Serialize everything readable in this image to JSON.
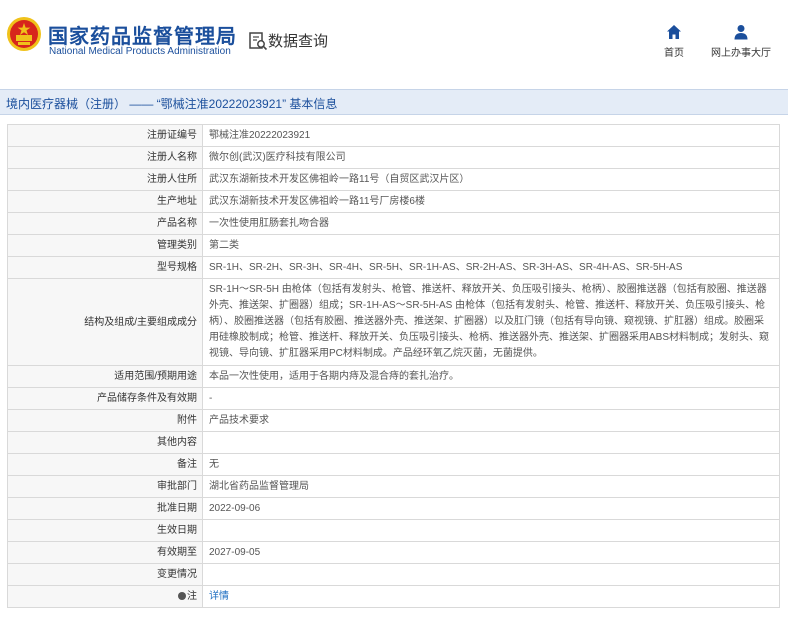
{
  "header": {
    "brand_cn": "国家药品监督管理局",
    "brand_en": "National Medical Products Administration",
    "query_title": "数据查询",
    "nav": {
      "home": "首页",
      "hall": "网上办事大厅"
    },
    "colors": {
      "brand": "#1b4f9c",
      "logo_red": "#d7261c",
      "logo_gold": "#f0c21a"
    }
  },
  "title_bar": {
    "text": "境内医疗器械（注册） —— “鄂械注准20222023921” 基本信息"
  },
  "rows": [
    {
      "label": "注册证编号",
      "value": "鄂械注准20222023921"
    },
    {
      "label": "注册人名称",
      "value": "微尔创(武汉)医疗科技有限公司"
    },
    {
      "label": "注册人住所",
      "value": "武汉东湖新技术开发区佛祖岭一路11号（自贸区武汉片区）"
    },
    {
      "label": "生产地址",
      "value": "武汉东湖新技术开发区佛祖岭一路11号厂房楼6楼"
    },
    {
      "label": "产品名称",
      "value": "一次性使用肛肠套扎吻合器"
    },
    {
      "label": "管理类别",
      "value": "第二类"
    },
    {
      "label": "型号规格",
      "value": "SR-1H、SR-2H、SR-3H、SR-4H、SR-5H、SR-1H-AS、SR-2H-AS、SR-3H-AS、SR-4H-AS、SR-5H-AS"
    },
    {
      "label": "结构及组成/主要组成成分",
      "value": "SR-1H～SR-5H 由枪体（包括有发射头、枪管、推送杆、释放开关、负压吸引接头、枪柄）、胶圈推送器（包括有胶圈、推送器外壳、推送架、扩圈器）组成；SR-1H-AS～SR-5H-AS 由枪体（包括有发射头、枪管、推送杆、释放开关、负压吸引接头、枪柄）、胶圈推送器（包括有胶圈、推送器外壳、推送架、扩圈器）以及肛门镜（包括有导向镜、窥视镜、扩肛器）组成。胶圈采用硅橡胶制成；枪管、推送杆、释放开关、负压吸引接头、枪柄、推送器外壳、推送架、扩圈器采用ABS材料制成；发射头、窥视镜、导向镜、扩肛器采用PC材料制成。产品经环氧乙烷灭菌，无菌提供。"
    },
    {
      "label": "适用范围/预期用途",
      "value": "本品一次性使用，适用于各期内痔及混合痔的套扎治疗。"
    },
    {
      "label": "产品储存条件及有效期",
      "value": "-"
    },
    {
      "label": "附件",
      "value": "产品技术要求"
    },
    {
      "label": "其他内容",
      "value": ""
    },
    {
      "label": "备注",
      "value": "无"
    },
    {
      "label": "审批部门",
      "value": "湖北省药品监督管理局"
    },
    {
      "label": "批准日期",
      "value": "2022-09-06"
    },
    {
      "label": "生效日期",
      "value": ""
    },
    {
      "label": "有效期至",
      "value": "2027-09-05"
    },
    {
      "label": "变更情况",
      "value": ""
    },
    {
      "label": "注",
      "value": "详情"
    }
  ]
}
